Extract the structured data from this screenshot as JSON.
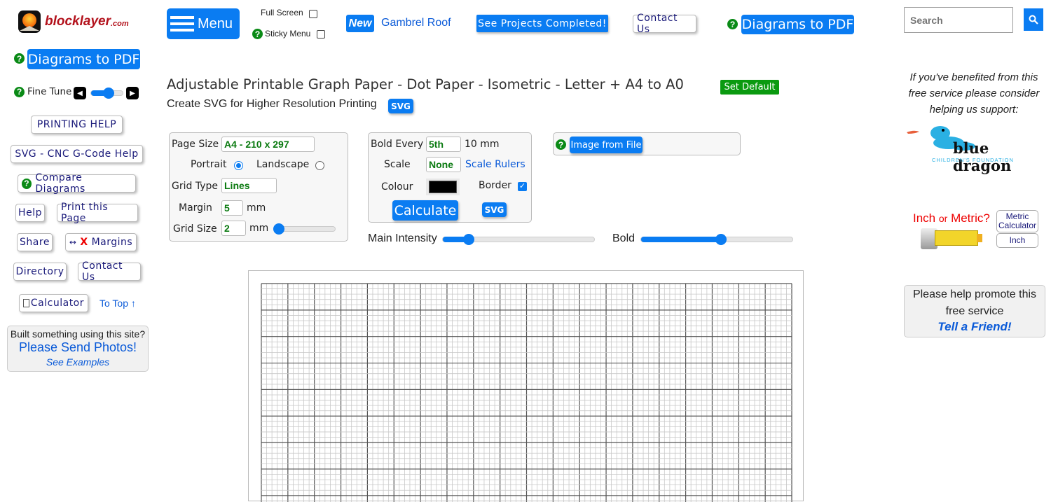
{
  "logo": {
    "text": "blocklayer",
    "suffix": ".com"
  },
  "sidebar": {
    "diagrams_pdf": "Diagrams to PDF",
    "fine_tune": "Fine Tune",
    "fine_tune_value": 0.55,
    "printing_help": "PRINTING HELP",
    "svg_help": "SVG - CNC G-Code Help",
    "compare": "Compare Diagrams",
    "help": "Help",
    "print_page": "Print this Page",
    "share": "Share",
    "margins_arrow": "↔",
    "margins_x": "X",
    "margins": "Margins",
    "directory": "Directory",
    "contact": "Contact Us",
    "calculator": "Calculator",
    "to_top": "To Top ↑",
    "photos_box": {
      "line1": "Built something using this site?",
      "line2": "Please Send Photos!",
      "line3": "See Examples"
    }
  },
  "topbar": {
    "menu": "Menu",
    "full_screen": "Full Screen",
    "sticky_menu": "Sticky Menu",
    "new_badge": "New",
    "gambrel": "Gambrel Roof",
    "projects": "See Projects Completed!",
    "contact": "Contact Us",
    "diagrams_pdf": "Diagrams to PDF"
  },
  "search": {
    "placeholder": "Search"
  },
  "main": {
    "title": "Adjustable Printable Graph Paper - Dot Paper - Isometric - Letter + A4 to A0",
    "set_default": "Set Default",
    "subtitle": "Create SVG for Higher Resolution Printing",
    "svg_label": "SVG"
  },
  "settings": {
    "page_size_label": "Page Size",
    "page_size": "A4 - 210 x 297",
    "portrait": "Portrait",
    "landscape": "Landscape",
    "orientation": "Portrait",
    "grid_type_label": "Grid Type",
    "grid_type": "Lines",
    "margin_label": "Margin",
    "margin": "5",
    "margin_unit": "mm",
    "grid_size_label": "Grid Size",
    "grid_size": "2",
    "grid_size_unit": "mm",
    "grid_size_slider": 0.06,
    "bold_every_label": "Bold Every",
    "bold_every": "5th",
    "bold_every_mm": "10 mm",
    "scale_label": "Scale",
    "scale": "None",
    "scale_rulers": "Scale Rulers",
    "colour_label": "Colour",
    "colour": "#000000",
    "border_label": "Border",
    "border_checked": true,
    "calculate": "Calculate",
    "svg": "SVG",
    "image_from_file": "Image from File",
    "main_intensity_label": "Main Intensity",
    "main_intensity": 0.17,
    "bold_label": "Bold",
    "bold": 0.53
  },
  "right": {
    "support_text": "If you've benefited from this free service please consider helping us support:",
    "blue_dragon": "blue dragon",
    "blue_dragon_sub": "CHILDREN'S FOUNDATION",
    "inch_or_metric_1": "Inch",
    "inch_or_metric_or": "or",
    "inch_or_metric_2": "Metric?",
    "metric_calc": "Metric Calculator",
    "inch": "Inch",
    "promote_line1": "Please help promote this free service",
    "tell_friend": "Tell a Friend!"
  },
  "grid": {
    "minor_per_bold": 5,
    "bold_cols": 20
  }
}
